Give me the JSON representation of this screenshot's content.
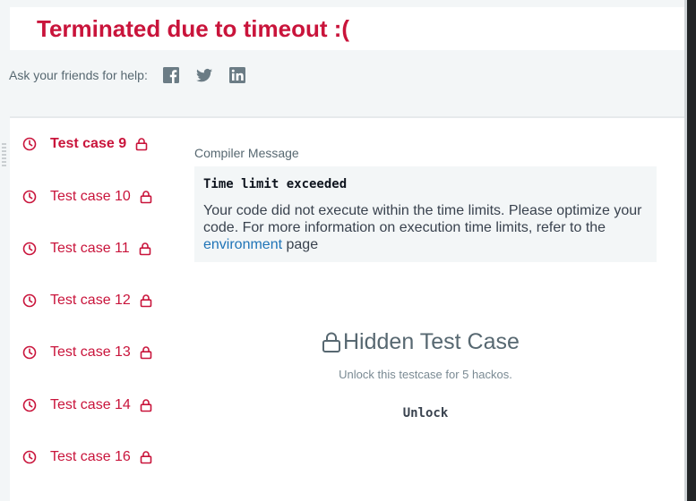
{
  "banner": {
    "title": "Terminated due to timeout :("
  },
  "share": {
    "label": "Ask your friends for help:",
    "icons": [
      "facebook-icon",
      "twitter-icon",
      "linkedin-icon"
    ]
  },
  "colors": {
    "accent": "#c9143b",
    "link": "#1f74b7",
    "text": "#39424e",
    "muted": "#576871",
    "panel_bg": "#ffffff",
    "page_bg": "#f3f6f7"
  },
  "test_cases": [
    {
      "label": "Test case 9",
      "active": true
    },
    {
      "label": "Test case 10",
      "active": false
    },
    {
      "label": "Test case 11",
      "active": false
    },
    {
      "label": "Test case 12",
      "active": false
    },
    {
      "label": "Test case 13",
      "active": false
    },
    {
      "label": "Test case 14",
      "active": false
    },
    {
      "label": "Test case 16",
      "active": false
    }
  ],
  "compiler": {
    "label": "Compiler Message",
    "heading": "Time limit exceeded",
    "body_before": "Your code did not execute within the time limits. Please optimize your code. For more information on execution time limits, refer to the ",
    "link_text": "environment",
    "body_after": " page"
  },
  "hidden": {
    "title": "Hidden Test Case",
    "subtitle": "Unlock this testcase for 5 hackos.",
    "unlock_label": "Unlock"
  }
}
